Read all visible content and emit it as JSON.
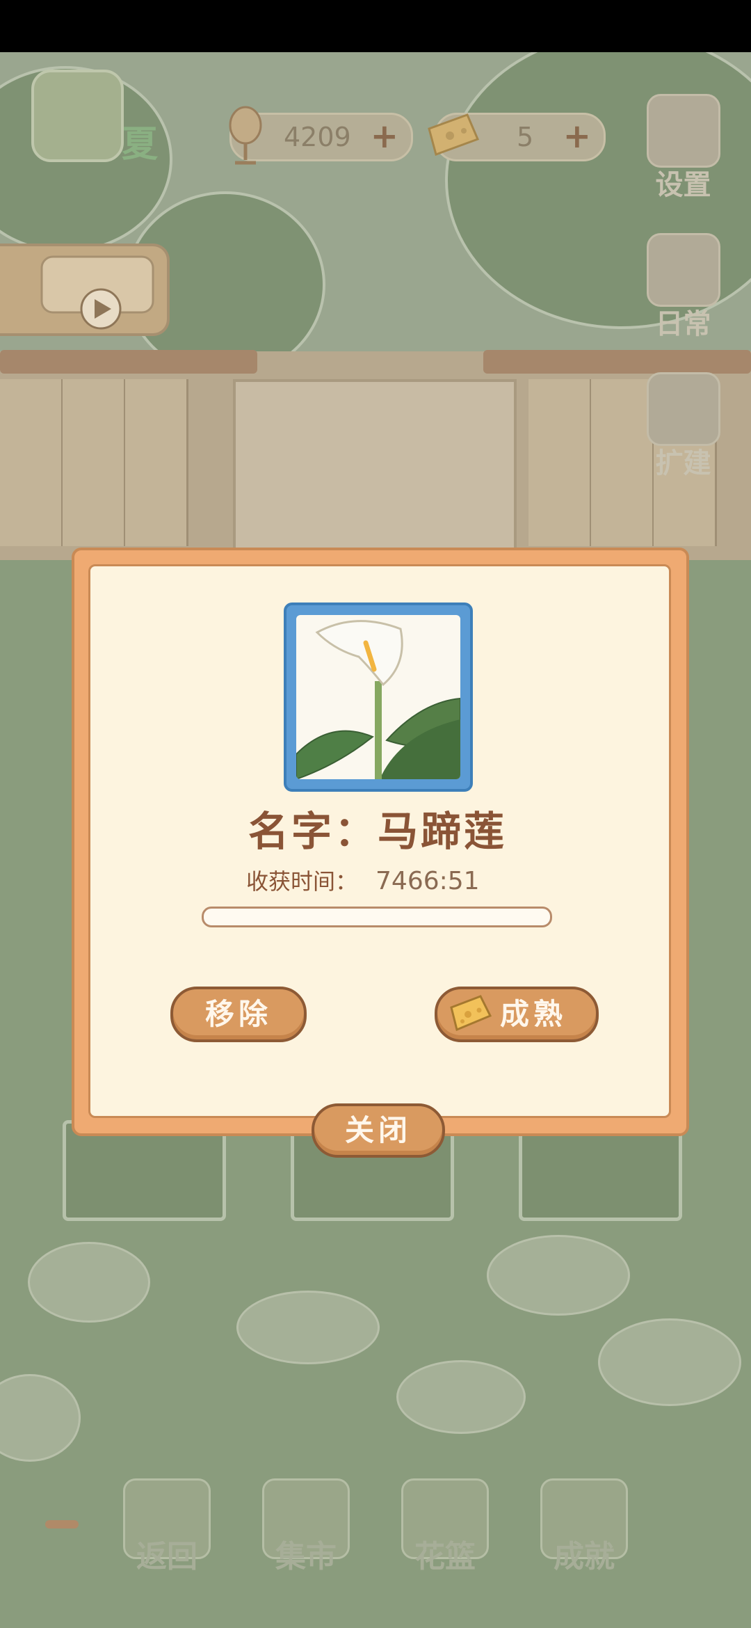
{
  "hud": {
    "season": "夏",
    "fish_count": "4209",
    "cheese_count": "5",
    "plus": "+",
    "settings_label": "设置",
    "daily_label": "日常",
    "expand_label": "扩建"
  },
  "dialog": {
    "name_label": "名字：",
    "plant_name": "马蹄莲",
    "harvest_label": "收获时间：",
    "harvest_time": "7466:51",
    "progress_fraction": 0.0,
    "remove_label": "移除",
    "mature_label": "成熟",
    "close_label": "关闭"
  },
  "nav": {
    "back_label": "返回",
    "market_label": "集市",
    "basket_label": "花篮",
    "achievement_label": "成就"
  },
  "colors": {
    "dialog_border": "#efaa72",
    "dialog_bg": "#fdf4df",
    "button": "#d99a60",
    "text_brown": "#8a5436",
    "frame_blue": "#5b9bd4"
  }
}
